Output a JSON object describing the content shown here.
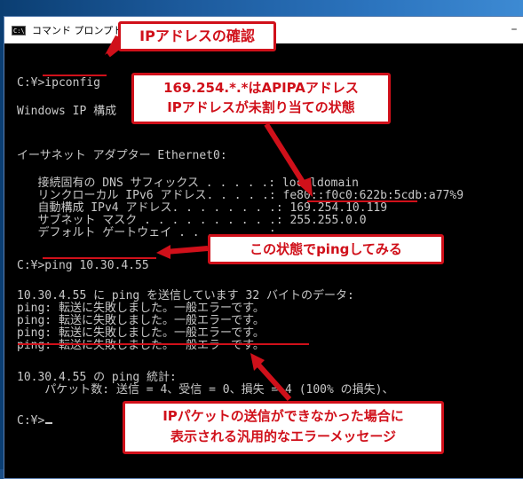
{
  "window": {
    "title": "コマンド プロンプト",
    "icon_text": "C:\\",
    "minimize": "–"
  },
  "console": {
    "lines": [
      "C:¥>ipconfig",
      "Windows IP 構成",
      "イーサネット アダプター Ethernet0:",
      "   接続固有の DNS サフィックス . . . . .: localdomain",
      "   リンクローカル IPv6 アドレス. . . . .: fe80::f0c0:622b:5cdb:a77%9",
      "   自動構成 IPv4 アドレス. . . . . . . .: 169.254.10.119",
      "   サブネット マスク . . . . . . . . . .: 255.255.0.0",
      "   デフォルト ゲートウェイ . . . . . . .:",
      "C:¥>ping 10.30.4.55",
      "10.30.4.55 に ping を送信しています 32 バイトのデータ:",
      "ping: 転送に失敗しました。一般エラーです。",
      "ping: 転送に失敗しました。一般エラーです。",
      "ping: 転送に失敗しました。一般エラーです。",
      "ping: 転送に失敗しました。一般エラーです。",
      "10.30.4.55 の ping 統計:",
      "    パケット数: 送信 = 4、受信 = 0、損失 = 4 (100% の損失)、",
      "C:¥>"
    ]
  },
  "callouts": {
    "ip_check": "IPアドレスの確認",
    "apipa_line1": "169.254.*.*はAPIPAアドレス",
    "apipa_line2": "IPアドレスが未割り当ての状態",
    "ping_try": "この状態でpingしてみる",
    "error_line1": "IPパケットの送信ができなかった場合に",
    "error_line2": "表示される汎用的なエラーメッセージ"
  },
  "colors": {
    "accent": "#d0101a",
    "console_text": "#c8c8c8",
    "console_bg": "#000000"
  }
}
